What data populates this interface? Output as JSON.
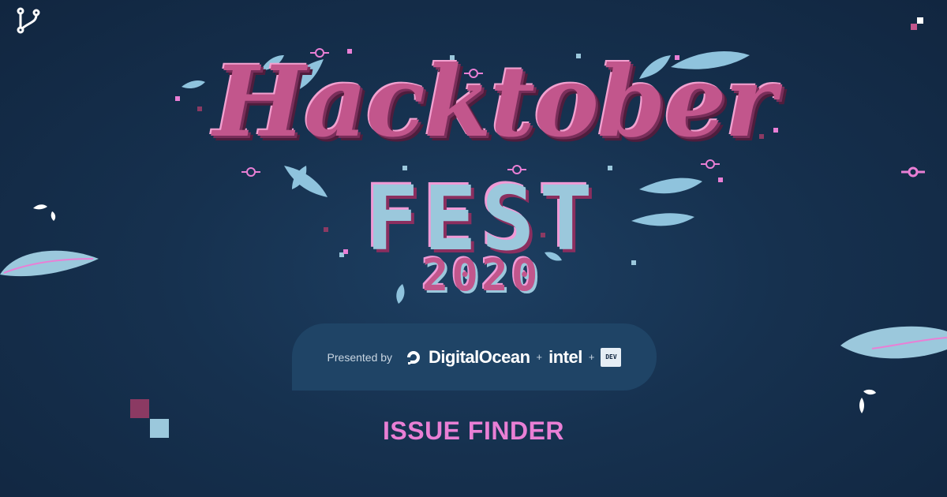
{
  "brand": {
    "title_line1": "Hacktober",
    "title_line2": "FEST",
    "title_year": "2020"
  },
  "sponsors": {
    "presented_label": "Presented by",
    "digitalocean": "DigitalOcean",
    "separator": "+",
    "intel": "intel",
    "dev": "DEV"
  },
  "page": {
    "heading": "ISSUE FINDER"
  },
  "colors": {
    "background": "#16314f",
    "pink": "#e97fd5",
    "magenta": "#c2568c",
    "light_blue": "#9bc8dc",
    "pill": "#1f4466"
  },
  "icons": [
    "git-branch-icon",
    "digitalocean-icon",
    "leaf-icon"
  ]
}
